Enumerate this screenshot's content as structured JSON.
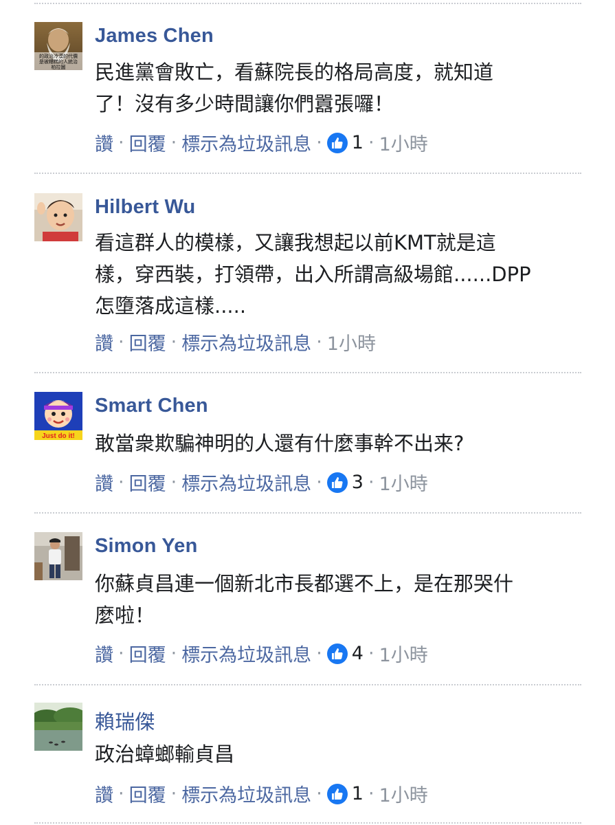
{
  "actions": {
    "like": "讚",
    "reply": "回覆",
    "mark_spam": "標示為垃圾訊息",
    "separator": "·"
  },
  "comments": [
    {
      "author": "James Chen",
      "lines": [
        "民進黨會敗亡，看蘇院長的格局高度，就知道",
        "了！沒有多少時間讓你們囂張囉！"
      ],
      "likes": "1",
      "time": "1小時",
      "avatar_icon": "bearded-man-painting-avatar",
      "avatar_caption": [
        "的政治冷漠的代價",
        "是被糟糕的人統治",
        "柏拉圖"
      ]
    },
    {
      "author": "Hilbert Wu",
      "lines": [
        "看這群人的模樣，又讓我想起以前KMT就是這",
        "樣，穿西裝，打領帶，出入所謂高級場館......DPP",
        "怎墮落成這樣....."
      ],
      "likes": "",
      "time": "1小時",
      "avatar_icon": "child-photo-avatar"
    },
    {
      "author": "Smart Chen",
      "lines": [
        "敢當衆欺騙神明的人還有什麼事幹不出来?"
      ],
      "likes": "3",
      "time": "1小時",
      "avatar_icon": "cartoon-kid-avatar",
      "avatar_caption": [
        "Just do it!"
      ]
    },
    {
      "author": "Simon Yen",
      "lines": [
        "你蘇貞昌連一個新北市長都選不上，是在那哭什",
        "麼啦！"
      ],
      "likes": "4",
      "time": "1小時",
      "avatar_icon": "man-standing-photo-avatar"
    },
    {
      "author": "賴瑞傑",
      "lines": [
        "政治蟑螂輸貞昌"
      ],
      "likes": "1",
      "time": "1小時",
      "avatar_icon": "lake-landscape-avatar"
    }
  ],
  "colors": {
    "author_blue": "#385898",
    "action_blue": "#4b67a1",
    "meta_gray": "#8d949e",
    "text": "#1c1e21",
    "like_blue": "#1877f2"
  }
}
